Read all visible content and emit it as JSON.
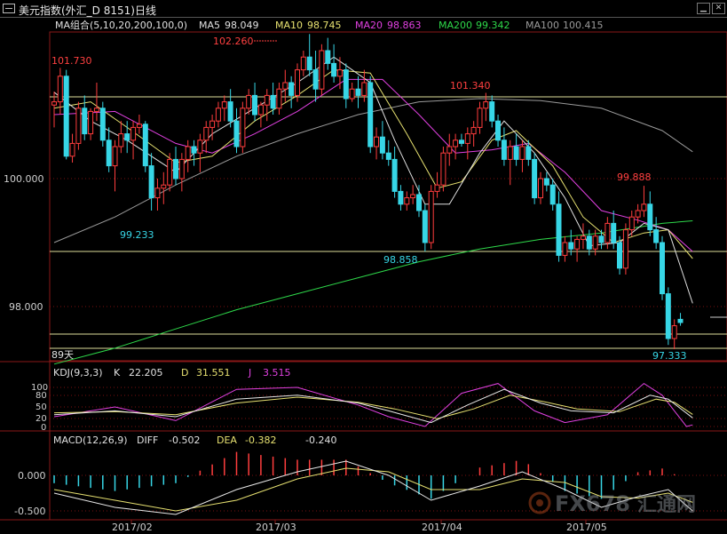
{
  "window": {
    "title": "美元指数(外汇_D 8151)日线",
    "minimize_label": "▁",
    "close_label": "✕"
  },
  "colors": {
    "background": "#000000",
    "up_candle": "#ff3d3d",
    "down_candle": "#37d6e6",
    "ma5": "#e0e0e0",
    "ma10": "#e6e070",
    "ma20": "#e040e0",
    "ma200": "#2ed84a",
    "ma100": "#9a9a9a",
    "kdj_k": "#e8e8e8",
    "kdj_d": "#e6e070",
    "kdj_j": "#e040e0",
    "grid_red": "#7a1010",
    "hline": "#dede9a"
  },
  "legend": {
    "group": "MA组合(5,10,20,200,100,0)",
    "items": [
      {
        "name": "MA5",
        "value": "98.049",
        "color": "#e0e0e0"
      },
      {
        "name": "MA10",
        "value": "98.745",
        "color": "#e6e070"
      },
      {
        "name": "MA20",
        "value": "98.863",
        "color": "#e040e0"
      },
      {
        "name": "MA200",
        "value": "99.342",
        "color": "#2ed84a"
      },
      {
        "name": "MA100",
        "value": "100.415",
        "color": "#9a9a9a"
      }
    ]
  },
  "annotations": {
    "high_1": "101.730",
    "high_2": "102.260",
    "high_3": "101.340",
    "high_4": "99.888",
    "low_1": "99.233",
    "low_2": "98.858",
    "low_3": "97.333",
    "days": "89天"
  },
  "kdj": {
    "title": "KDJ(9,3,3)",
    "k_label": "K",
    "k_value": "22.205",
    "d_label": "D",
    "d_value": "31.551",
    "j_label": "J",
    "j_value": "3.515",
    "ticks": [
      "100",
      "80",
      "50",
      "20",
      "0"
    ]
  },
  "macd": {
    "title": "MACD(12,26,9)",
    "diff_label": "DIFF",
    "diff_value": "-0.502",
    "dea_label": "DEA",
    "dea_value": "-0.382",
    "macd_value": "-0.240",
    "ticks": [
      "0.000",
      "-0.500"
    ]
  },
  "watermark": {
    "brand": "FX678",
    "cn": "汇通网"
  },
  "chart_data": {
    "type": "candlestick",
    "title": "美元指数(外汇_D 8151)日线",
    "y_ticks": [
      100.0,
      98.0
    ],
    "y_tick_labels": [
      "100.000",
      "98.000"
    ],
    "x_labels": [
      "2017/02",
      "2017/03",
      "2017/04",
      "2017/05"
    ],
    "horizontal_lines": [
      101.29,
      98.86,
      97.45,
      97.3
    ],
    "ohlc": [
      [
        101.15,
        101.36,
        100.8,
        101.2
      ],
      [
        101.2,
        101.73,
        101.0,
        101.6
      ],
      [
        101.6,
        101.7,
        100.3,
        100.35
      ],
      [
        100.35,
        100.7,
        100.25,
        100.55
      ],
      [
        100.55,
        101.2,
        100.45,
        101.1
      ],
      [
        101.1,
        101.3,
        100.6,
        100.7
      ],
      [
        100.7,
        101.1,
        100.6,
        101.05
      ],
      [
        101.05,
        101.5,
        100.9,
        101.1
      ],
      [
        101.1,
        101.2,
        100.5,
        100.6
      ],
      [
        100.6,
        100.8,
        100.1,
        100.2
      ],
      [
        100.2,
        100.6,
        99.8,
        100.5
      ],
      [
        100.5,
        100.9,
        100.4,
        100.7
      ],
      [
        100.7,
        100.9,
        100.4,
        100.6
      ],
      [
        100.6,
        100.9,
        100.3,
        100.8
      ],
      [
        100.8,
        101.0,
        100.7,
        100.85
      ],
      [
        100.85,
        100.9,
        100.1,
        100.2
      ],
      [
        100.2,
        100.4,
        99.5,
        99.7
      ],
      [
        99.7,
        100.0,
        99.5,
        99.85
      ],
      [
        99.85,
        100.1,
        99.6,
        99.9
      ],
      [
        99.9,
        100.4,
        99.8,
        100.3
      ],
      [
        100.3,
        100.5,
        99.9,
        100.0
      ],
      [
        100.0,
        100.4,
        99.8,
        100.3
      ],
      [
        100.3,
        100.6,
        100.1,
        100.5
      ],
      [
        100.5,
        100.6,
        100.2,
        100.4
      ],
      [
        100.4,
        100.7,
        100.1,
        100.6
      ],
      [
        100.6,
        100.9,
        100.4,
        100.8
      ],
      [
        100.8,
        101.0,
        100.6,
        100.9
      ],
      [
        100.9,
        101.2,
        100.8,
        101.1
      ],
      [
        101.1,
        101.3,
        100.9,
        101.2
      ],
      [
        101.2,
        101.4,
        100.8,
        100.9
      ],
      [
        100.9,
        101.1,
        100.4,
        100.5
      ],
      [
        100.5,
        101.2,
        100.4,
        101.1
      ],
      [
        101.1,
        101.4,
        101.0,
        101.3
      ],
      [
        101.3,
        101.5,
        100.9,
        101.0
      ],
      [
        101.0,
        101.2,
        100.8,
        101.15
      ],
      [
        101.15,
        101.4,
        100.9,
        101.3
      ],
      [
        101.3,
        101.5,
        101.0,
        101.1
      ],
      [
        101.1,
        101.5,
        101.0,
        101.4
      ],
      [
        101.4,
        101.7,
        101.2,
        101.5
      ],
      [
        101.5,
        101.6,
        101.1,
        101.3
      ],
      [
        101.3,
        101.8,
        101.2,
        101.7
      ],
      [
        101.7,
        102.0,
        101.6,
        101.9
      ],
      [
        101.9,
        102.26,
        101.6,
        101.7
      ],
      [
        101.7,
        102.0,
        101.2,
        101.4
      ],
      [
        101.4,
        102.1,
        101.3,
        102.0
      ],
      [
        102.0,
        102.2,
        101.7,
        101.8
      ],
      [
        101.8,
        102.1,
        101.5,
        101.6
      ],
      [
        101.6,
        101.9,
        101.4,
        101.7
      ],
      [
        101.7,
        101.8,
        101.1,
        101.25
      ],
      [
        101.25,
        101.5,
        101.2,
        101.4
      ],
      [
        101.4,
        101.6,
        101.1,
        101.3
      ],
      [
        101.3,
        101.7,
        101.2,
        101.5
      ],
      [
        101.5,
        101.6,
        100.4,
        100.5
      ],
      [
        100.5,
        100.8,
        100.3,
        100.65
      ],
      [
        100.65,
        100.9,
        100.3,
        100.4
      ],
      [
        100.4,
        100.6,
        100.2,
        100.3
      ],
      [
        100.3,
        100.5,
        99.7,
        99.8
      ],
      [
        99.8,
        99.9,
        99.5,
        99.6
      ],
      [
        99.6,
        99.8,
        99.5,
        99.7
      ],
      [
        99.7,
        99.9,
        99.6,
        99.75
      ],
      [
        99.75,
        99.9,
        99.4,
        99.5
      ],
      [
        99.5,
        99.6,
        98.86,
        99.0
      ],
      [
        99.0,
        99.9,
        98.9,
        99.8
      ],
      [
        99.8,
        100.1,
        99.7,
        99.9
      ],
      [
        99.9,
        100.5,
        99.8,
        100.4
      ],
      [
        100.4,
        100.7,
        100.2,
        100.5
      ],
      [
        100.5,
        100.7,
        100.3,
        100.6
      ],
      [
        100.6,
        100.7,
        100.5,
        100.55
      ],
      [
        100.55,
        100.8,
        100.3,
        100.7
      ],
      [
        100.7,
        100.9,
        100.5,
        100.8
      ],
      [
        100.8,
        101.2,
        100.7,
        101.1
      ],
      [
        101.1,
        101.34,
        100.9,
        101.2
      ],
      [
        101.2,
        101.3,
        100.8,
        100.9
      ],
      [
        100.9,
        101.0,
        100.5,
        100.6
      ],
      [
        100.6,
        100.8,
        100.2,
        100.3
      ],
      [
        100.3,
        100.6,
        99.9,
        100.5
      ],
      [
        100.5,
        100.7,
        100.2,
        100.3
      ],
      [
        100.3,
        100.6,
        100.1,
        100.5
      ],
      [
        100.5,
        100.6,
        100.2,
        100.3
      ],
      [
        100.3,
        100.4,
        99.6,
        99.7
      ],
      [
        99.7,
        100.1,
        99.6,
        100.0
      ],
      [
        100.0,
        100.1,
        99.8,
        99.9
      ],
      [
        99.9,
        100.0,
        99.5,
        99.6
      ],
      [
        99.6,
        99.8,
        98.7,
        98.8
      ],
      [
        98.8,
        99.1,
        98.7,
        99.0
      ],
      [
        99.0,
        99.2,
        98.8,
        98.9
      ],
      [
        98.9,
        99.1,
        98.7,
        99.05
      ],
      [
        99.05,
        99.3,
        98.9,
        99.1
      ],
      [
        99.1,
        99.2,
        98.8,
        98.9
      ],
      [
        98.9,
        99.2,
        98.8,
        99.1
      ],
      [
        99.1,
        99.2,
        98.9,
        99.0
      ],
      [
        99.0,
        99.4,
        98.9,
        99.3
      ],
      [
        99.3,
        99.5,
        98.9,
        99.0
      ],
      [
        99.0,
        99.1,
        98.5,
        98.6
      ],
      [
        98.6,
        99.3,
        98.5,
        99.2
      ],
      [
        99.2,
        99.5,
        99.1,
        99.4
      ],
      [
        99.4,
        99.6,
        99.3,
        99.5
      ],
      [
        99.5,
        99.888,
        99.4,
        99.6
      ],
      [
        99.6,
        99.8,
        99.1,
        99.2
      ],
      [
        99.2,
        99.4,
        98.9,
        99.0
      ],
      [
        99.0,
        99.1,
        98.1,
        98.2
      ],
      [
        98.2,
        98.3,
        97.4,
        97.5
      ],
      [
        97.5,
        97.8,
        97.333,
        97.7
      ],
      [
        97.8,
        97.9,
        97.7,
        97.75
      ]
    ],
    "overlays": {
      "ma5": [
        [
          0,
          101.35
        ],
        [
          6,
          100.9
        ],
        [
          12,
          100.6
        ],
        [
          20,
          100.1
        ],
        [
          26,
          100.7
        ],
        [
          33,
          101.1
        ],
        [
          40,
          101.5
        ],
        [
          46,
          101.9
        ],
        [
          52,
          101.5
        ],
        [
          56,
          100.6
        ],
        [
          61,
          99.6
        ],
        [
          65,
          99.6
        ],
        [
          70,
          100.4
        ],
        [
          74,
          100.9
        ],
        [
          79,
          100.4
        ],
        [
          84,
          99.7
        ],
        [
          88,
          98.95
        ],
        [
          93,
          99.0
        ],
        [
          97,
          99.3
        ],
        [
          101,
          99.2
        ],
        [
          105,
          98.05
        ]
      ],
      "ma10": [
        [
          0,
          101.1
        ],
        [
          6,
          101.2
        ],
        [
          12,
          100.8
        ],
        [
          20,
          100.25
        ],
        [
          26,
          100.35
        ],
        [
          33,
          100.9
        ],
        [
          40,
          101.3
        ],
        [
          46,
          101.7
        ],
        [
          52,
          101.65
        ],
        [
          58,
          100.7
        ],
        [
          63,
          99.85
        ],
        [
          67,
          99.95
        ],
        [
          72,
          100.6
        ],
        [
          76,
          100.75
        ],
        [
          82,
          100.2
        ],
        [
          87,
          99.4
        ],
        [
          92,
          99.0
        ],
        [
          97,
          99.15
        ],
        [
          101,
          99.2
        ],
        [
          105,
          98.75
        ]
      ],
      "ma20": [
        [
          0,
          101.0
        ],
        [
          10,
          101.05
        ],
        [
          20,
          100.55
        ],
        [
          26,
          100.4
        ],
        [
          33,
          100.7
        ],
        [
          40,
          101.05
        ],
        [
          48,
          101.55
        ],
        [
          54,
          101.55
        ],
        [
          60,
          101.0
        ],
        [
          66,
          100.4
        ],
        [
          72,
          100.45
        ],
        [
          78,
          100.55
        ],
        [
          84,
          100.1
        ],
        [
          90,
          99.5
        ],
        [
          96,
          99.35
        ],
        [
          101,
          99.2
        ],
        [
          105,
          98.86
        ]
      ],
      "ma200": [
        [
          0,
          97.1
        ],
        [
          10,
          97.35
        ],
        [
          20,
          97.65
        ],
        [
          30,
          97.95
        ],
        [
          40,
          98.2
        ],
        [
          50,
          98.45
        ],
        [
          60,
          98.7
        ],
        [
          70,
          98.9
        ],
        [
          80,
          99.05
        ],
        [
          90,
          99.15
        ],
        [
          100,
          99.3
        ],
        [
          105,
          99.34
        ]
      ],
      "ma100": [
        [
          0,
          99.0
        ],
        [
          10,
          99.4
        ],
        [
          20,
          99.9
        ],
        [
          30,
          100.35
        ],
        [
          40,
          100.7
        ],
        [
          50,
          101.0
        ],
        [
          60,
          101.2
        ],
        [
          70,
          101.25
        ],
        [
          80,
          101.22
        ],
        [
          90,
          101.1
        ],
        [
          100,
          100.75
        ],
        [
          105,
          100.42
        ]
      ]
    },
    "kdj_series": {
      "k": [
        [
          0,
          30
        ],
        [
          10,
          40
        ],
        [
          20,
          25
        ],
        [
          30,
          70
        ],
        [
          40,
          80
        ],
        [
          50,
          60
        ],
        [
          55,
          40
        ],
        [
          62,
          10
        ],
        [
          68,
          55
        ],
        [
          74,
          95
        ],
        [
          80,
          60
        ],
        [
          85,
          40
        ],
        [
          92,
          35
        ],
        [
          98,
          80
        ],
        [
          101,
          70
        ],
        [
          105,
          22
        ]
      ],
      "d": [
        [
          0,
          35
        ],
        [
          10,
          38
        ],
        [
          20,
          30
        ],
        [
          30,
          60
        ],
        [
          40,
          75
        ],
        [
          50,
          62
        ],
        [
          56,
          45
        ],
        [
          63,
          20
        ],
        [
          69,
          45
        ],
        [
          75,
          80
        ],
        [
          81,
          62
        ],
        [
          86,
          45
        ],
        [
          93,
          38
        ],
        [
          99,
          70
        ],
        [
          102,
          62
        ],
        [
          105,
          31
        ]
      ],
      "j": [
        [
          0,
          25
        ],
        [
          10,
          50
        ],
        [
          20,
          15
        ],
        [
          30,
          95
        ],
        [
          40,
          100
        ],
        [
          50,
          55
        ],
        [
          55,
          25
        ],
        [
          61,
          0
        ],
        [
          67,
          85
        ],
        [
          73,
          110
        ],
        [
          79,
          40
        ],
        [
          84,
          10
        ],
        [
          91,
          30
        ],
        [
          97,
          110
        ],
        [
          100,
          80
        ],
        [
          104,
          0
        ],
        [
          105,
          4
        ]
      ]
    },
    "macd_series": {
      "diff": [
        [
          0,
          -0.25
        ],
        [
          10,
          -0.45
        ],
        [
          20,
          -0.55
        ],
        [
          30,
          -0.2
        ],
        [
          40,
          0.05
        ],
        [
          48,
          0.2
        ],
        [
          55,
          0.0
        ],
        [
          62,
          -0.35
        ],
        [
          70,
          -0.15
        ],
        [
          77,
          0.05
        ],
        [
          84,
          -0.2
        ],
        [
          90,
          -0.45
        ],
        [
          96,
          -0.3
        ],
        [
          101,
          -0.2
        ],
        [
          105,
          -0.5
        ]
      ],
      "dea": [
        [
          0,
          -0.2
        ],
        [
          10,
          -0.35
        ],
        [
          20,
          -0.5
        ],
        [
          30,
          -0.35
        ],
        [
          40,
          -0.05
        ],
        [
          48,
          0.1
        ],
        [
          55,
          0.05
        ],
        [
          62,
          -0.2
        ],
        [
          70,
          -0.2
        ],
        [
          77,
          -0.05
        ],
        [
          84,
          -0.1
        ],
        [
          90,
          -0.3
        ],
        [
          96,
          -0.32
        ],
        [
          101,
          -0.25
        ],
        [
          105,
          -0.38
        ]
      ]
    }
  }
}
